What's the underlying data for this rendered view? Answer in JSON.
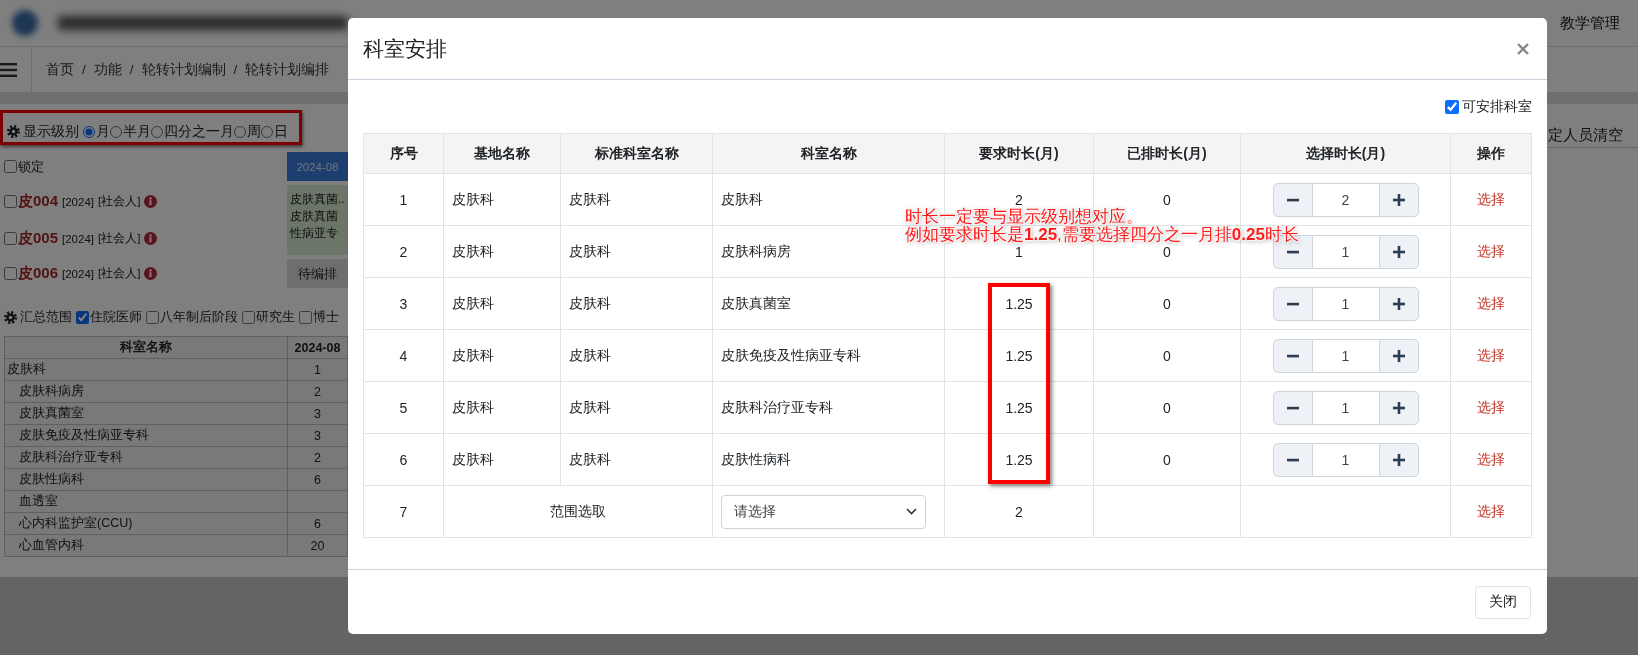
{
  "top_nav": {
    "menu_item": "教学管理"
  },
  "breadcrumb": {
    "separator": "/",
    "items": [
      "首页",
      "功能",
      "轮转计划编制",
      "轮转计划编排"
    ]
  },
  "display_level": {
    "label": "显示级别",
    "highlighted": true,
    "options": [
      {
        "label": "月",
        "selected": true
      },
      {
        "label": "半月",
        "selected": false
      },
      {
        "label": "四分之一月",
        "selected": false
      },
      {
        "label": "周",
        "selected": false
      },
      {
        "label": "日",
        "selected": false
      }
    ]
  },
  "lock": {
    "label": "锁定",
    "checked": false
  },
  "people": [
    {
      "code": "皮004",
      "year": "[2024]",
      "tag": "[社会人]",
      "checked": false
    },
    {
      "code": "皮005",
      "year": "[2024]",
      "tag": "[社会人]",
      "checked": false
    },
    {
      "code": "皮006",
      "year": "[2024]",
      "tag": "[社会人]",
      "checked": false
    }
  ],
  "calendar": {
    "month": "2024-08",
    "cells": [
      {
        "kind": "assigned",
        "lines": [
          "皮肤真菌..",
          "皮肤真菌",
          "性病亚专"
        ]
      },
      {
        "kind": "pending",
        "lines": [
          "待编排"
        ]
      }
    ]
  },
  "summary": {
    "label": "汇总范围",
    "filters": [
      {
        "label": "住院医师",
        "checked": true
      },
      {
        "label": "八年制后阶段",
        "checked": false
      },
      {
        "label": "研究生",
        "checked": false
      },
      {
        "label": "博士",
        "checked": false
      }
    ]
  },
  "summary_table": {
    "columns": [
      "科室名称",
      "2024-08"
    ],
    "rows": [
      {
        "name": "皮肤科",
        "value": "1",
        "children": [
          {
            "name": "皮肤科病房",
            "value": "2"
          },
          {
            "name": "皮肤真菌室",
            "value": "3"
          },
          {
            "name": "皮肤免疫及性病亚专科",
            "value": "3"
          },
          {
            "name": "皮肤科治疗亚专科",
            "value": "2"
          },
          {
            "name": "皮肤性病科",
            "value": "6"
          },
          {
            "name": "血透室"
          },
          {
            "name": "心内科监护室(CCU)",
            "value": "6"
          },
          {
            "name": "心血管内科",
            "value": "20"
          }
        ]
      }
    ]
  },
  "right_action": "定人员清空",
  "modal": {
    "title": "科室安排",
    "arrangeable": {
      "label": "可安排科室",
      "checked": true
    },
    "table": {
      "columns": [
        "序号",
        "基地名称",
        "标准科室名称",
        "科室名称",
        "要求时长(月)",
        "已排时长(月)",
        "选择时长(月)",
        "操作"
      ],
      "rows": [
        {
          "kind": "department",
          "index": "1",
          "base": "皮肤科",
          "standard": "皮肤科",
          "dept": "皮肤科",
          "required": "2",
          "scheduled": "0",
          "chosen": "2",
          "action": "选择",
          "highlighted": false
        },
        {
          "kind": "department",
          "index": "2",
          "base": "皮肤科",
          "standard": "皮肤科",
          "dept": "皮肤科病房",
          "required": "1",
          "scheduled": "0",
          "chosen": "1",
          "action": "选择",
          "highlighted": false
        },
        {
          "kind": "department",
          "index": "3",
          "base": "皮肤科",
          "standard": "皮肤科",
          "dept": "皮肤真菌室",
          "required": "1.25",
          "scheduled": "0",
          "chosen": "1",
          "action": "选择",
          "highlighted": true
        },
        {
          "kind": "department",
          "index": "4",
          "base": "皮肤科",
          "standard": "皮肤科",
          "dept": "皮肤免疫及性病亚专科",
          "required": "1.25",
          "scheduled": "0",
          "chosen": "1",
          "action": "选择",
          "highlighted": true
        },
        {
          "kind": "department",
          "index": "5",
          "base": "皮肤科",
          "standard": "皮肤科",
          "dept": "皮肤科治疗亚专科",
          "required": "1.25",
          "scheduled": "0",
          "chosen": "1",
          "action": "选择",
          "highlighted": true
        },
        {
          "kind": "department",
          "index": "6",
          "base": "皮肤科",
          "standard": "皮肤科",
          "dept": "皮肤性病科",
          "required": "1.25",
          "scheduled": "0",
          "chosen": "1",
          "action": "选择",
          "highlighted": true
        },
        {
          "kind": "range",
          "index": "7",
          "label": "范围选取",
          "select": "请选择",
          "required": "2",
          "action": "选择"
        }
      ]
    },
    "footer_button": "关闭"
  },
  "annotation": {
    "lines": [
      "时长一定要与显示级别想对应。",
      "例如要求时长是**1.25**,需要选择四分之一月排**0.25**时长"
    ]
  }
}
